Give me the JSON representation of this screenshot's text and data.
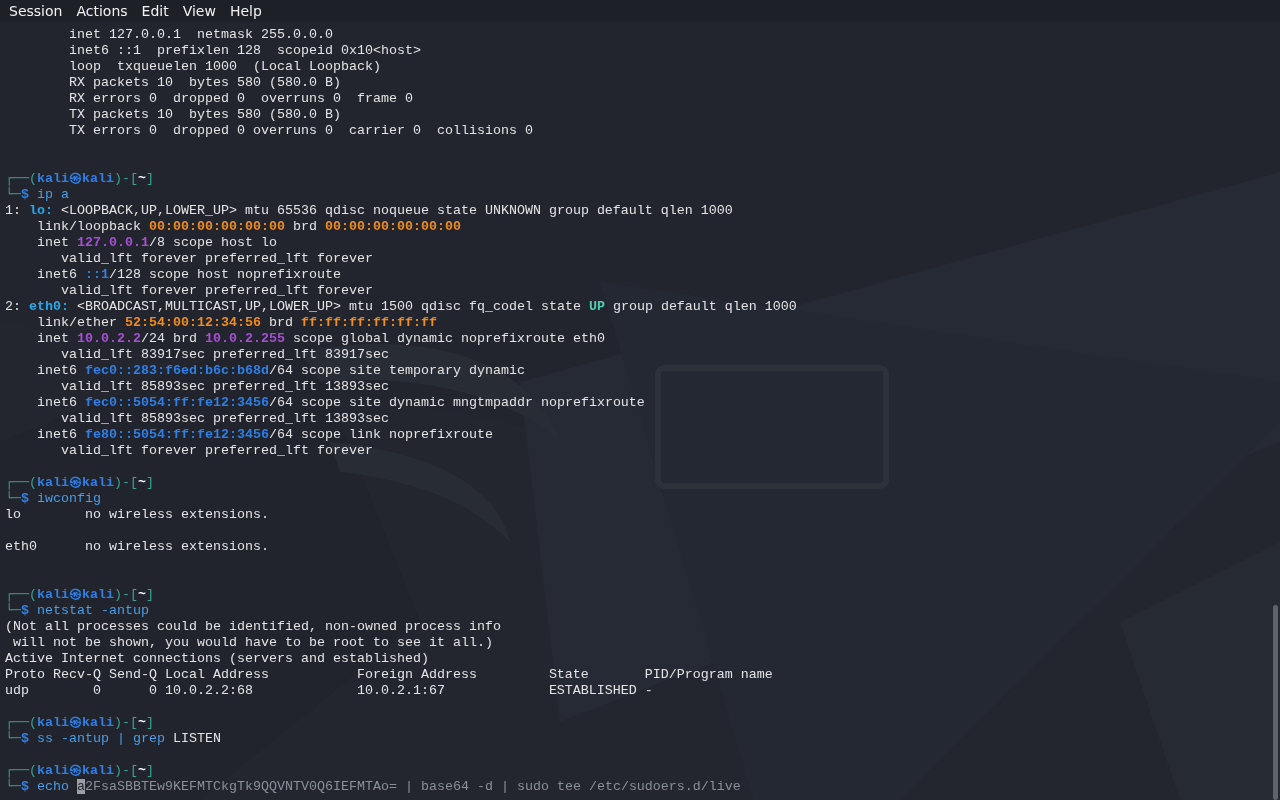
{
  "menu": [
    "Session",
    "Actions",
    "Edit",
    "View",
    "Help"
  ],
  "lines": [
    {
      "kind": "output",
      "parts": [
        {
          "kind": "plain",
          "text": "        inet 127.0.0.1  netmask 255.0.0.0"
        }
      ]
    },
    {
      "kind": "output",
      "parts": [
        {
          "kind": "plain",
          "text": "        inet6 ::1  prefixlen 128  scopeid 0x10<host>"
        }
      ]
    },
    {
      "kind": "output",
      "parts": [
        {
          "kind": "plain",
          "text": "        loop  txqueuelen 1000  (Local Loopback)"
        }
      ]
    },
    {
      "kind": "output",
      "parts": [
        {
          "kind": "plain",
          "text": "        RX packets 10  bytes 580 (580.0 B)"
        }
      ]
    },
    {
      "kind": "output",
      "parts": [
        {
          "kind": "plain",
          "text": "        RX errors 0  dropped 0  overruns 0  frame 0"
        }
      ]
    },
    {
      "kind": "output",
      "parts": [
        {
          "kind": "plain",
          "text": "        TX packets 10  bytes 580 (580.0 B)"
        }
      ]
    },
    {
      "kind": "output",
      "parts": [
        {
          "kind": "plain",
          "text": "        TX errors 0  dropped 0 overruns 0  carrier 0  collisions 0"
        }
      ]
    },
    {
      "kind": "blank"
    },
    {
      "kind": "blank"
    },
    {
      "kind": "prompt",
      "parts": [
        {
          "kind": "frame",
          "text": "┌──("
        },
        {
          "kind": "user",
          "text": "kali㉿kali"
        },
        {
          "kind": "frame",
          "text": ")-["
        },
        {
          "kind": "path",
          "text": "~"
        },
        {
          "kind": "frame",
          "text": "]"
        }
      ]
    },
    {
      "kind": "command",
      "parts": [
        {
          "kind": "frame",
          "text": "└─"
        },
        {
          "kind": "user",
          "text": "$"
        },
        {
          "kind": "cmd",
          "text": " ip a"
        }
      ]
    },
    {
      "kind": "output",
      "parts": [
        {
          "kind": "plain",
          "text": "1: "
        },
        {
          "kind": "iface",
          "text": "lo:"
        },
        {
          "kind": "plain",
          "text": " <LOOPBACK,UP,LOWER_UP> mtu 65536 qdisc noqueue state UNKNOWN group default qlen 1000"
        }
      ]
    },
    {
      "kind": "output",
      "parts": [
        {
          "kind": "plain",
          "text": "    link/loopback "
        },
        {
          "kind": "mac",
          "text": "00:00:00:00:00:00"
        },
        {
          "kind": "plain",
          "text": " brd "
        },
        {
          "kind": "mac",
          "text": "00:00:00:00:00:00"
        }
      ]
    },
    {
      "kind": "output",
      "parts": [
        {
          "kind": "plain",
          "text": "    inet "
        },
        {
          "kind": "ipv4",
          "text": "127.0.0.1"
        },
        {
          "kind": "plain",
          "text": "/8 scope host lo"
        }
      ]
    },
    {
      "kind": "output",
      "parts": [
        {
          "kind": "plain",
          "text": "       valid_lft forever preferred_lft forever"
        }
      ]
    },
    {
      "kind": "output",
      "parts": [
        {
          "kind": "plain",
          "text": "    inet6 "
        },
        {
          "kind": "ipv6",
          "text": "::1"
        },
        {
          "kind": "plain",
          "text": "/128 scope host noprefixroute"
        }
      ]
    },
    {
      "kind": "output",
      "parts": [
        {
          "kind": "plain",
          "text": "       valid_lft forever preferred_lft forever"
        }
      ]
    },
    {
      "kind": "output",
      "parts": [
        {
          "kind": "plain",
          "text": "2: "
        },
        {
          "kind": "iface",
          "text": "eth0:"
        },
        {
          "kind": "plain",
          "text": " <BROADCAST,MULTICAST,UP,LOWER_UP> mtu 1500 qdisc fq_codel state "
        },
        {
          "kind": "up",
          "text": "UP"
        },
        {
          "kind": "plain",
          "text": " group default qlen 1000"
        }
      ]
    },
    {
      "kind": "output",
      "parts": [
        {
          "kind": "plain",
          "text": "    link/ether "
        },
        {
          "kind": "mac",
          "text": "52:54:00:12:34:56"
        },
        {
          "kind": "plain",
          "text": " brd "
        },
        {
          "kind": "mac",
          "text": "ff:ff:ff:ff:ff:ff"
        }
      ]
    },
    {
      "kind": "output",
      "parts": [
        {
          "kind": "plain",
          "text": "    inet "
        },
        {
          "kind": "ipv4",
          "text": "10.0.2.2"
        },
        {
          "kind": "plain",
          "text": "/24 brd "
        },
        {
          "kind": "ipv4",
          "text": "10.0.2.255"
        },
        {
          "kind": "plain",
          "text": " scope global dynamic noprefixroute eth0"
        }
      ]
    },
    {
      "kind": "output",
      "parts": [
        {
          "kind": "plain",
          "text": "       valid_lft 83917sec preferred_lft 83917sec"
        }
      ]
    },
    {
      "kind": "output",
      "parts": [
        {
          "kind": "plain",
          "text": "    inet6 "
        },
        {
          "kind": "ipv6",
          "text": "fec0::283:f6ed:b6c:b68d"
        },
        {
          "kind": "plain",
          "text": "/64 scope site temporary dynamic"
        }
      ]
    },
    {
      "kind": "output",
      "parts": [
        {
          "kind": "plain",
          "text": "       valid_lft 85893sec preferred_lft 13893sec"
        }
      ]
    },
    {
      "kind": "output",
      "parts": [
        {
          "kind": "plain",
          "text": "    inet6 "
        },
        {
          "kind": "ipv6",
          "text": "fec0::5054:ff:fe12:3456"
        },
        {
          "kind": "plain",
          "text": "/64 scope site dynamic mngtmpaddr noprefixroute"
        }
      ]
    },
    {
      "kind": "output",
      "parts": [
        {
          "kind": "plain",
          "text": "       valid_lft 85893sec preferred_lft 13893sec"
        }
      ]
    },
    {
      "kind": "output",
      "parts": [
        {
          "kind": "plain",
          "text": "    inet6 "
        },
        {
          "kind": "ipv6",
          "text": "fe80::5054:ff:fe12:3456"
        },
        {
          "kind": "plain",
          "text": "/64 scope link noprefixroute"
        }
      ]
    },
    {
      "kind": "output",
      "parts": [
        {
          "kind": "plain",
          "text": "       valid_lft forever preferred_lft forever"
        }
      ]
    },
    {
      "kind": "blank"
    },
    {
      "kind": "prompt",
      "parts": [
        {
          "kind": "frame",
          "text": "┌──("
        },
        {
          "kind": "user",
          "text": "kali㉿kali"
        },
        {
          "kind": "frame",
          "text": ")-["
        },
        {
          "kind": "path",
          "text": "~"
        },
        {
          "kind": "frame",
          "text": "]"
        }
      ]
    },
    {
      "kind": "command",
      "parts": [
        {
          "kind": "frame",
          "text": "└─"
        },
        {
          "kind": "user",
          "text": "$"
        },
        {
          "kind": "cmd",
          "text": " iwconfig"
        }
      ]
    },
    {
      "kind": "output",
      "parts": [
        {
          "kind": "plain",
          "text": "lo        no wireless extensions."
        }
      ]
    },
    {
      "kind": "blank"
    },
    {
      "kind": "output",
      "parts": [
        {
          "kind": "plain",
          "text": "eth0      no wireless extensions."
        }
      ]
    },
    {
      "kind": "blank"
    },
    {
      "kind": "blank"
    },
    {
      "kind": "prompt",
      "parts": [
        {
          "kind": "frame",
          "text": "┌──("
        },
        {
          "kind": "user",
          "text": "kali㉿kali"
        },
        {
          "kind": "frame",
          "text": ")-["
        },
        {
          "kind": "path",
          "text": "~"
        },
        {
          "kind": "frame",
          "text": "]"
        }
      ]
    },
    {
      "kind": "command",
      "parts": [
        {
          "kind": "frame",
          "text": "└─"
        },
        {
          "kind": "user",
          "text": "$"
        },
        {
          "kind": "cmd",
          "text": " netstat -antup"
        }
      ]
    },
    {
      "kind": "output",
      "parts": [
        {
          "kind": "plain",
          "text": "(Not all processes could be identified, non-owned process info"
        }
      ]
    },
    {
      "kind": "output",
      "parts": [
        {
          "kind": "plain",
          "text": " will not be shown, you would have to be root to see it all.)"
        }
      ]
    },
    {
      "kind": "output",
      "parts": [
        {
          "kind": "plain",
          "text": "Active Internet connections (servers and established)"
        }
      ]
    },
    {
      "kind": "output",
      "parts": [
        {
          "kind": "plain",
          "text": "Proto Recv-Q Send-Q Local Address           Foreign Address         State       PID/Program name"
        }
      ]
    },
    {
      "kind": "output",
      "parts": [
        {
          "kind": "plain",
          "text": "udp        0      0 10.0.2.2:68             10.0.2.1:67             ESTABLISHED -"
        }
      ]
    },
    {
      "kind": "blank"
    },
    {
      "kind": "prompt",
      "parts": [
        {
          "kind": "frame",
          "text": "┌──("
        },
        {
          "kind": "user",
          "text": "kali㉿kali"
        },
        {
          "kind": "frame",
          "text": ")-["
        },
        {
          "kind": "path",
          "text": "~"
        },
        {
          "kind": "frame",
          "text": "]"
        }
      ]
    },
    {
      "kind": "command",
      "parts": [
        {
          "kind": "frame",
          "text": "└─"
        },
        {
          "kind": "user",
          "text": "$"
        },
        {
          "kind": "cmd",
          "text": " ss -antup | grep"
        },
        {
          "kind": "plain",
          "text": " LISTEN"
        }
      ]
    },
    {
      "kind": "blank"
    },
    {
      "kind": "prompt",
      "parts": [
        {
          "kind": "frame",
          "text": "┌──("
        },
        {
          "kind": "user",
          "text": "kali㉿kali"
        },
        {
          "kind": "frame",
          "text": ")-["
        },
        {
          "kind": "path",
          "text": "~"
        },
        {
          "kind": "frame",
          "text": "]"
        }
      ]
    },
    {
      "kind": "command",
      "parts": [
        {
          "kind": "frame",
          "text": "└─"
        },
        {
          "kind": "user",
          "text": "$"
        },
        {
          "kind": "cmd",
          "text": " echo "
        },
        {
          "kind": "cursor",
          "text": "a"
        },
        {
          "kind": "suggestion",
          "text": "2FsaSBBTEw9KEFMTCkgTk9QQVNTV0Q6IEFMTAo= | base64 -d | sudo tee /etc/sudoers.d/live"
        }
      ]
    }
  ]
}
